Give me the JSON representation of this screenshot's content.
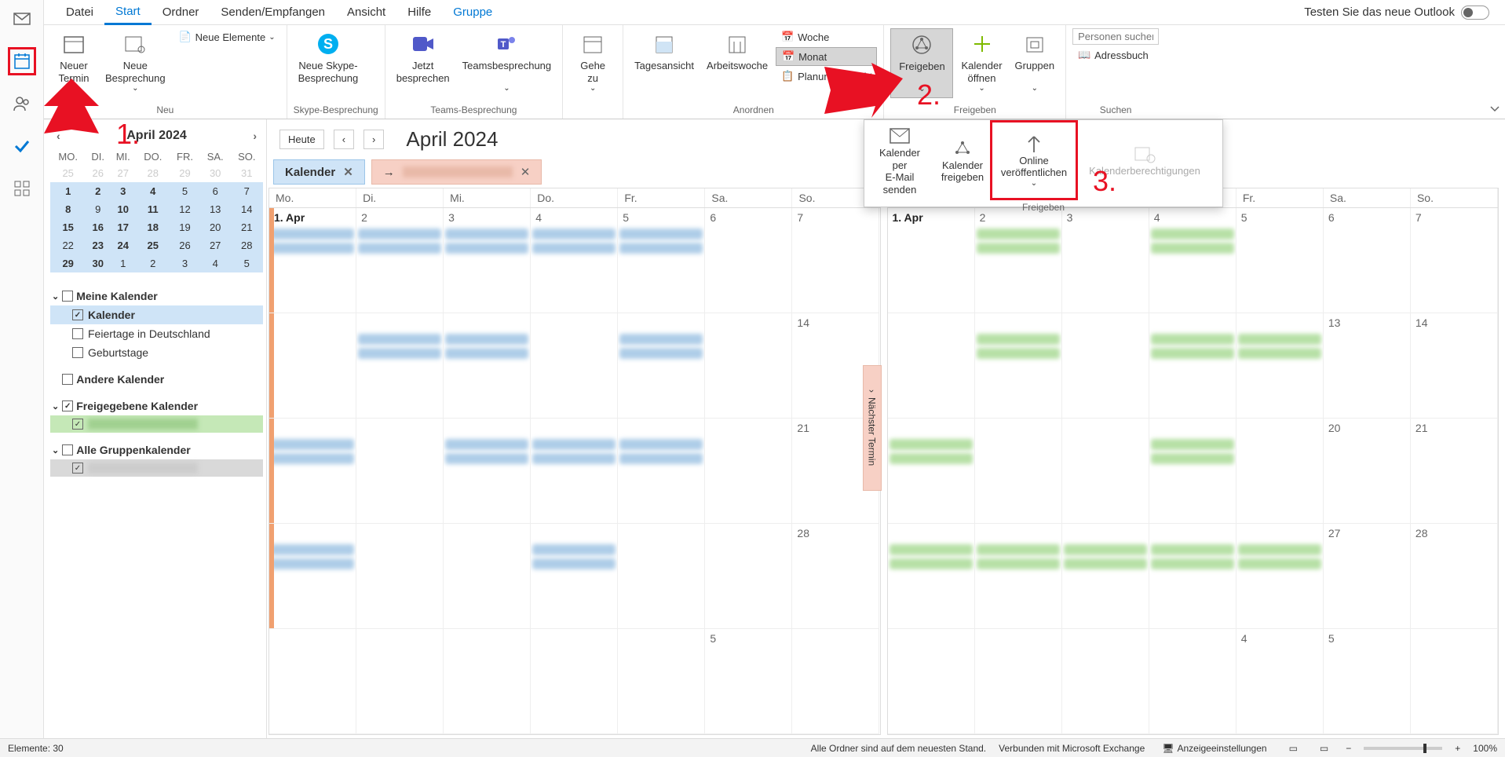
{
  "menubar": {
    "tabs": [
      "Datei",
      "Start",
      "Ordner",
      "Senden/Empfangen",
      "Ansicht",
      "Hilfe",
      "Gruppe"
    ],
    "active_index": 1,
    "toggle_label": "Testen Sie das neue Outlook"
  },
  "ribbon": {
    "neu": {
      "neuer_termin": "Neuer\nTermin",
      "neue_besprechung": "Neue\nBesprechung",
      "neue_elemente": "Neue Elemente",
      "label": "Neu"
    },
    "skype": {
      "btn": "Neue Skype-\nBesprechung",
      "label": "Skype-Besprechung"
    },
    "teams": {
      "jetzt": "Jetzt\nbesprechen",
      "meeting": "Teamsbesprechung",
      "label": "Teams-Besprechung"
    },
    "gehezu": {
      "btn": "Gehe\nzu",
      "label": ""
    },
    "anordnen": {
      "tag": "Tagesansicht",
      "arbeit": "Arbeitswoche",
      "woche": "Woche",
      "monat": "Monat",
      "planung": "Planungsansicht",
      "label": "Anordnen"
    },
    "freigeben": {
      "btn": "Freigeben",
      "oeffnen": "Kalender\nöffnen",
      "gruppen": "Gruppen",
      "label": "Freigeben"
    },
    "suchen": {
      "placeholder": "Personen suchen",
      "adressbuch": "Adressbuch",
      "label": "Suchen"
    }
  },
  "popup": {
    "email": "Kalender per\nE-Mail senden",
    "freigeben": "Kalender\nfreigeben",
    "online": "Online\nveröffentlichen",
    "berechtigungen": "Kalenderberechtigungen",
    "label": "Freigeben"
  },
  "annotations": {
    "n1": "1.",
    "n2": "2.",
    "n3": "3."
  },
  "sidepanel": {
    "month": "April 2024",
    "dow": [
      "MO.",
      "DI.",
      "MI.",
      "DO.",
      "FR.",
      "SA.",
      "SO."
    ],
    "weeks": [
      [
        {
          "d": "25",
          "dim": true
        },
        {
          "d": "26",
          "dim": true
        },
        {
          "d": "27",
          "dim": true
        },
        {
          "d": "28",
          "dim": true
        },
        {
          "d": "29",
          "dim": true
        },
        {
          "d": "30",
          "dim": true
        },
        {
          "d": "31",
          "dim": true
        }
      ],
      [
        {
          "d": "1",
          "b": true
        },
        {
          "d": "2",
          "b": true
        },
        {
          "d": "3",
          "b": true
        },
        {
          "d": "4",
          "b": true
        },
        {
          "d": "5"
        },
        {
          "d": "6"
        },
        {
          "d": "7"
        }
      ],
      [
        {
          "d": "8",
          "b": true
        },
        {
          "d": "9"
        },
        {
          "d": "10",
          "b": true
        },
        {
          "d": "11",
          "b": true
        },
        {
          "d": "12"
        },
        {
          "d": "13"
        },
        {
          "d": "14"
        }
      ],
      [
        {
          "d": "15",
          "b": true
        },
        {
          "d": "16",
          "b": true
        },
        {
          "d": "17",
          "b": true
        },
        {
          "d": "18",
          "b": true
        },
        {
          "d": "19"
        },
        {
          "d": "20"
        },
        {
          "d": "21"
        }
      ],
      [
        {
          "d": "22"
        },
        {
          "d": "23",
          "b": true
        },
        {
          "d": "24",
          "b": true
        },
        {
          "d": "25",
          "b": true
        },
        {
          "d": "26"
        },
        {
          "d": "27"
        },
        {
          "d": "28"
        }
      ],
      [
        {
          "d": "29",
          "b": true
        },
        {
          "d": "30",
          "b": true
        },
        {
          "d": "1"
        },
        {
          "d": "2"
        },
        {
          "d": "3"
        },
        {
          "d": "4"
        },
        {
          "d": "5"
        }
      ]
    ],
    "groups": {
      "meine": "Meine Kalender",
      "kalender": "Kalender",
      "feiertage": "Feiertage in Deutschland",
      "geburtstage": "Geburtstage",
      "andere": "Andere Kalender",
      "freigegebene": "Freigegebene Kalender",
      "alle_gruppen": "Alle Gruppenkalender"
    }
  },
  "cal": {
    "heute": "Heute",
    "title": "April 2024",
    "tab1": "Kalender",
    "dow": [
      "Mo.",
      "Di.",
      "Mi.",
      "Do.",
      "Fr.",
      "Sa.",
      "So."
    ],
    "first": "1. Apr",
    "nums_left": [
      "2",
      "3",
      "4",
      "5",
      "6",
      "7",
      "",
      "",
      "",
      "",
      "",
      "",
      "14",
      "",
      "",
      "",
      "",
      "",
      "",
      "21",
      "",
      "",
      "",
      "",
      "",
      "",
      "28",
      "",
      "",
      "",
      "",
      "",
      "5"
    ],
    "nums_right": [
      "2",
      "3",
      "4",
      "5",
      "6",
      "7",
      "",
      "",
      "",
      "",
      "",
      "13",
      "14",
      "",
      "",
      "",
      "",
      "",
      "20",
      "21",
      "",
      "",
      "",
      "",
      "",
      "27",
      "28",
      "",
      "",
      "",
      "",
      "4",
      "5"
    ],
    "next": "Nächster Termin"
  },
  "status": {
    "elemente": "Elemente: 30",
    "sync": "Alle Ordner sind auf dem neuesten Stand.",
    "verbunden": "Verbunden mit Microsoft Exchange",
    "anzeige": "Anzeigeeinstellungen",
    "zoom": "100%"
  }
}
